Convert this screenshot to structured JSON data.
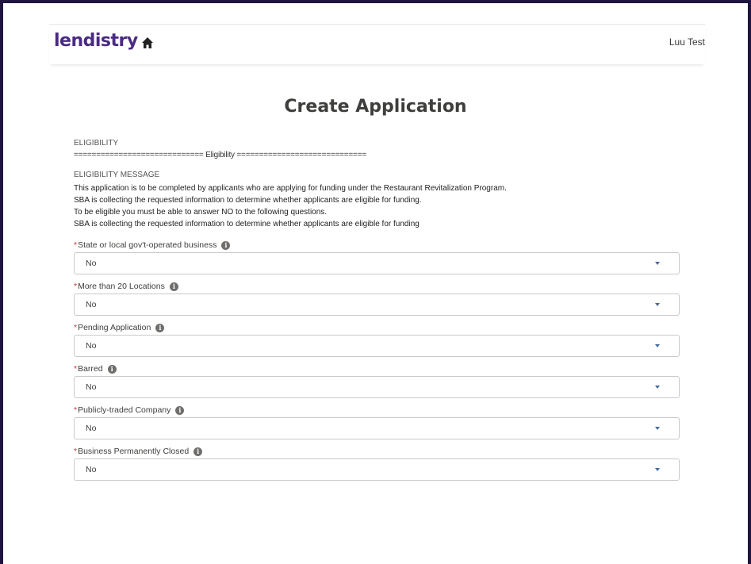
{
  "header": {
    "logo_text": "lendistry",
    "user_name": "Luu Test"
  },
  "page": {
    "title": "Create Application"
  },
  "eligibility": {
    "section_label": "ELIGIBILITY",
    "divider": "============================= Eligibility =============================",
    "message_label": "ELIGIBILITY MESSAGE",
    "message_lines": [
      "This application is to be completed by applicants who are applying for funding under the Restaurant Revitalization Program.",
      "SBA is collecting the requested information to determine whether applicants are eligible for funding.",
      "To be eligible you must be able to answer NO to the following questions.",
      "SBA is collecting the requested information to determine whether applicants are eligible for funding"
    ]
  },
  "fields": [
    {
      "required_mark": "*",
      "label": "State or local gov't-operated business",
      "value": "No"
    },
    {
      "required_mark": "*",
      "label": "More than 20 Locations",
      "value": "No"
    },
    {
      "required_mark": "*",
      "label": "Pending Application",
      "value": "No"
    },
    {
      "required_mark": "*",
      "label": "Barred",
      "value": "No"
    },
    {
      "required_mark": "*",
      "label": "Publicly-traded Company",
      "value": "No"
    },
    {
      "required_mark": "*",
      "label": "Business Permanently Closed",
      "value": "No"
    }
  ],
  "icons": {
    "home": "home-icon",
    "info": "info-icon",
    "dropdown": "chevron-down-icon"
  },
  "colors": {
    "brand": "#4a2a82",
    "required": "#c23934",
    "outer": "#1f1540"
  }
}
